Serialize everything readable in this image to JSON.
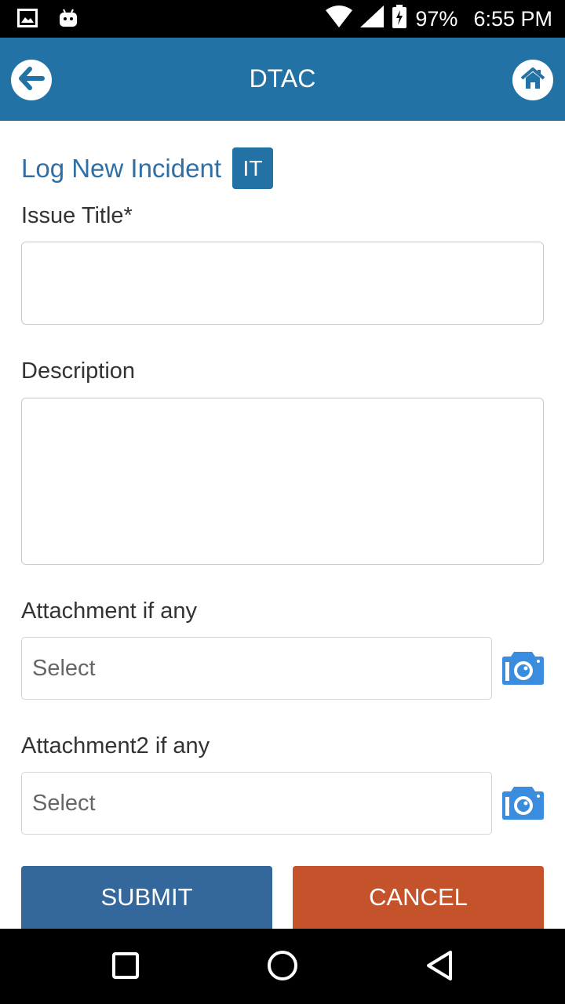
{
  "status_bar": {
    "battery": "97%",
    "time": "6:55 PM"
  },
  "app_bar": {
    "title": "DTAC"
  },
  "form": {
    "heading": "Log New Incident",
    "category_badge": "IT",
    "issue_title_label": "Issue Title*",
    "issue_title_value": "",
    "description_label": "Description",
    "description_value": "",
    "attachment1_label": "Attachment if any",
    "attachment1_value": "Select",
    "attachment2_label": "Attachment2 if any",
    "attachment2_value": "Select",
    "submit_label": "SUBMIT",
    "cancel_label": "CANCEL"
  },
  "colors": {
    "app_bar": "#2272a6",
    "submit": "#34679c",
    "cancel": "#c4532b",
    "camera_icon": "#3a8dde"
  },
  "icons": [
    "gallery-icon",
    "android-icon",
    "wifi-icon",
    "signal-icon",
    "battery-icon",
    "back-arrow-icon",
    "home-icon",
    "camera-icon",
    "recents-icon",
    "home-nav-icon",
    "back-nav-icon"
  ]
}
